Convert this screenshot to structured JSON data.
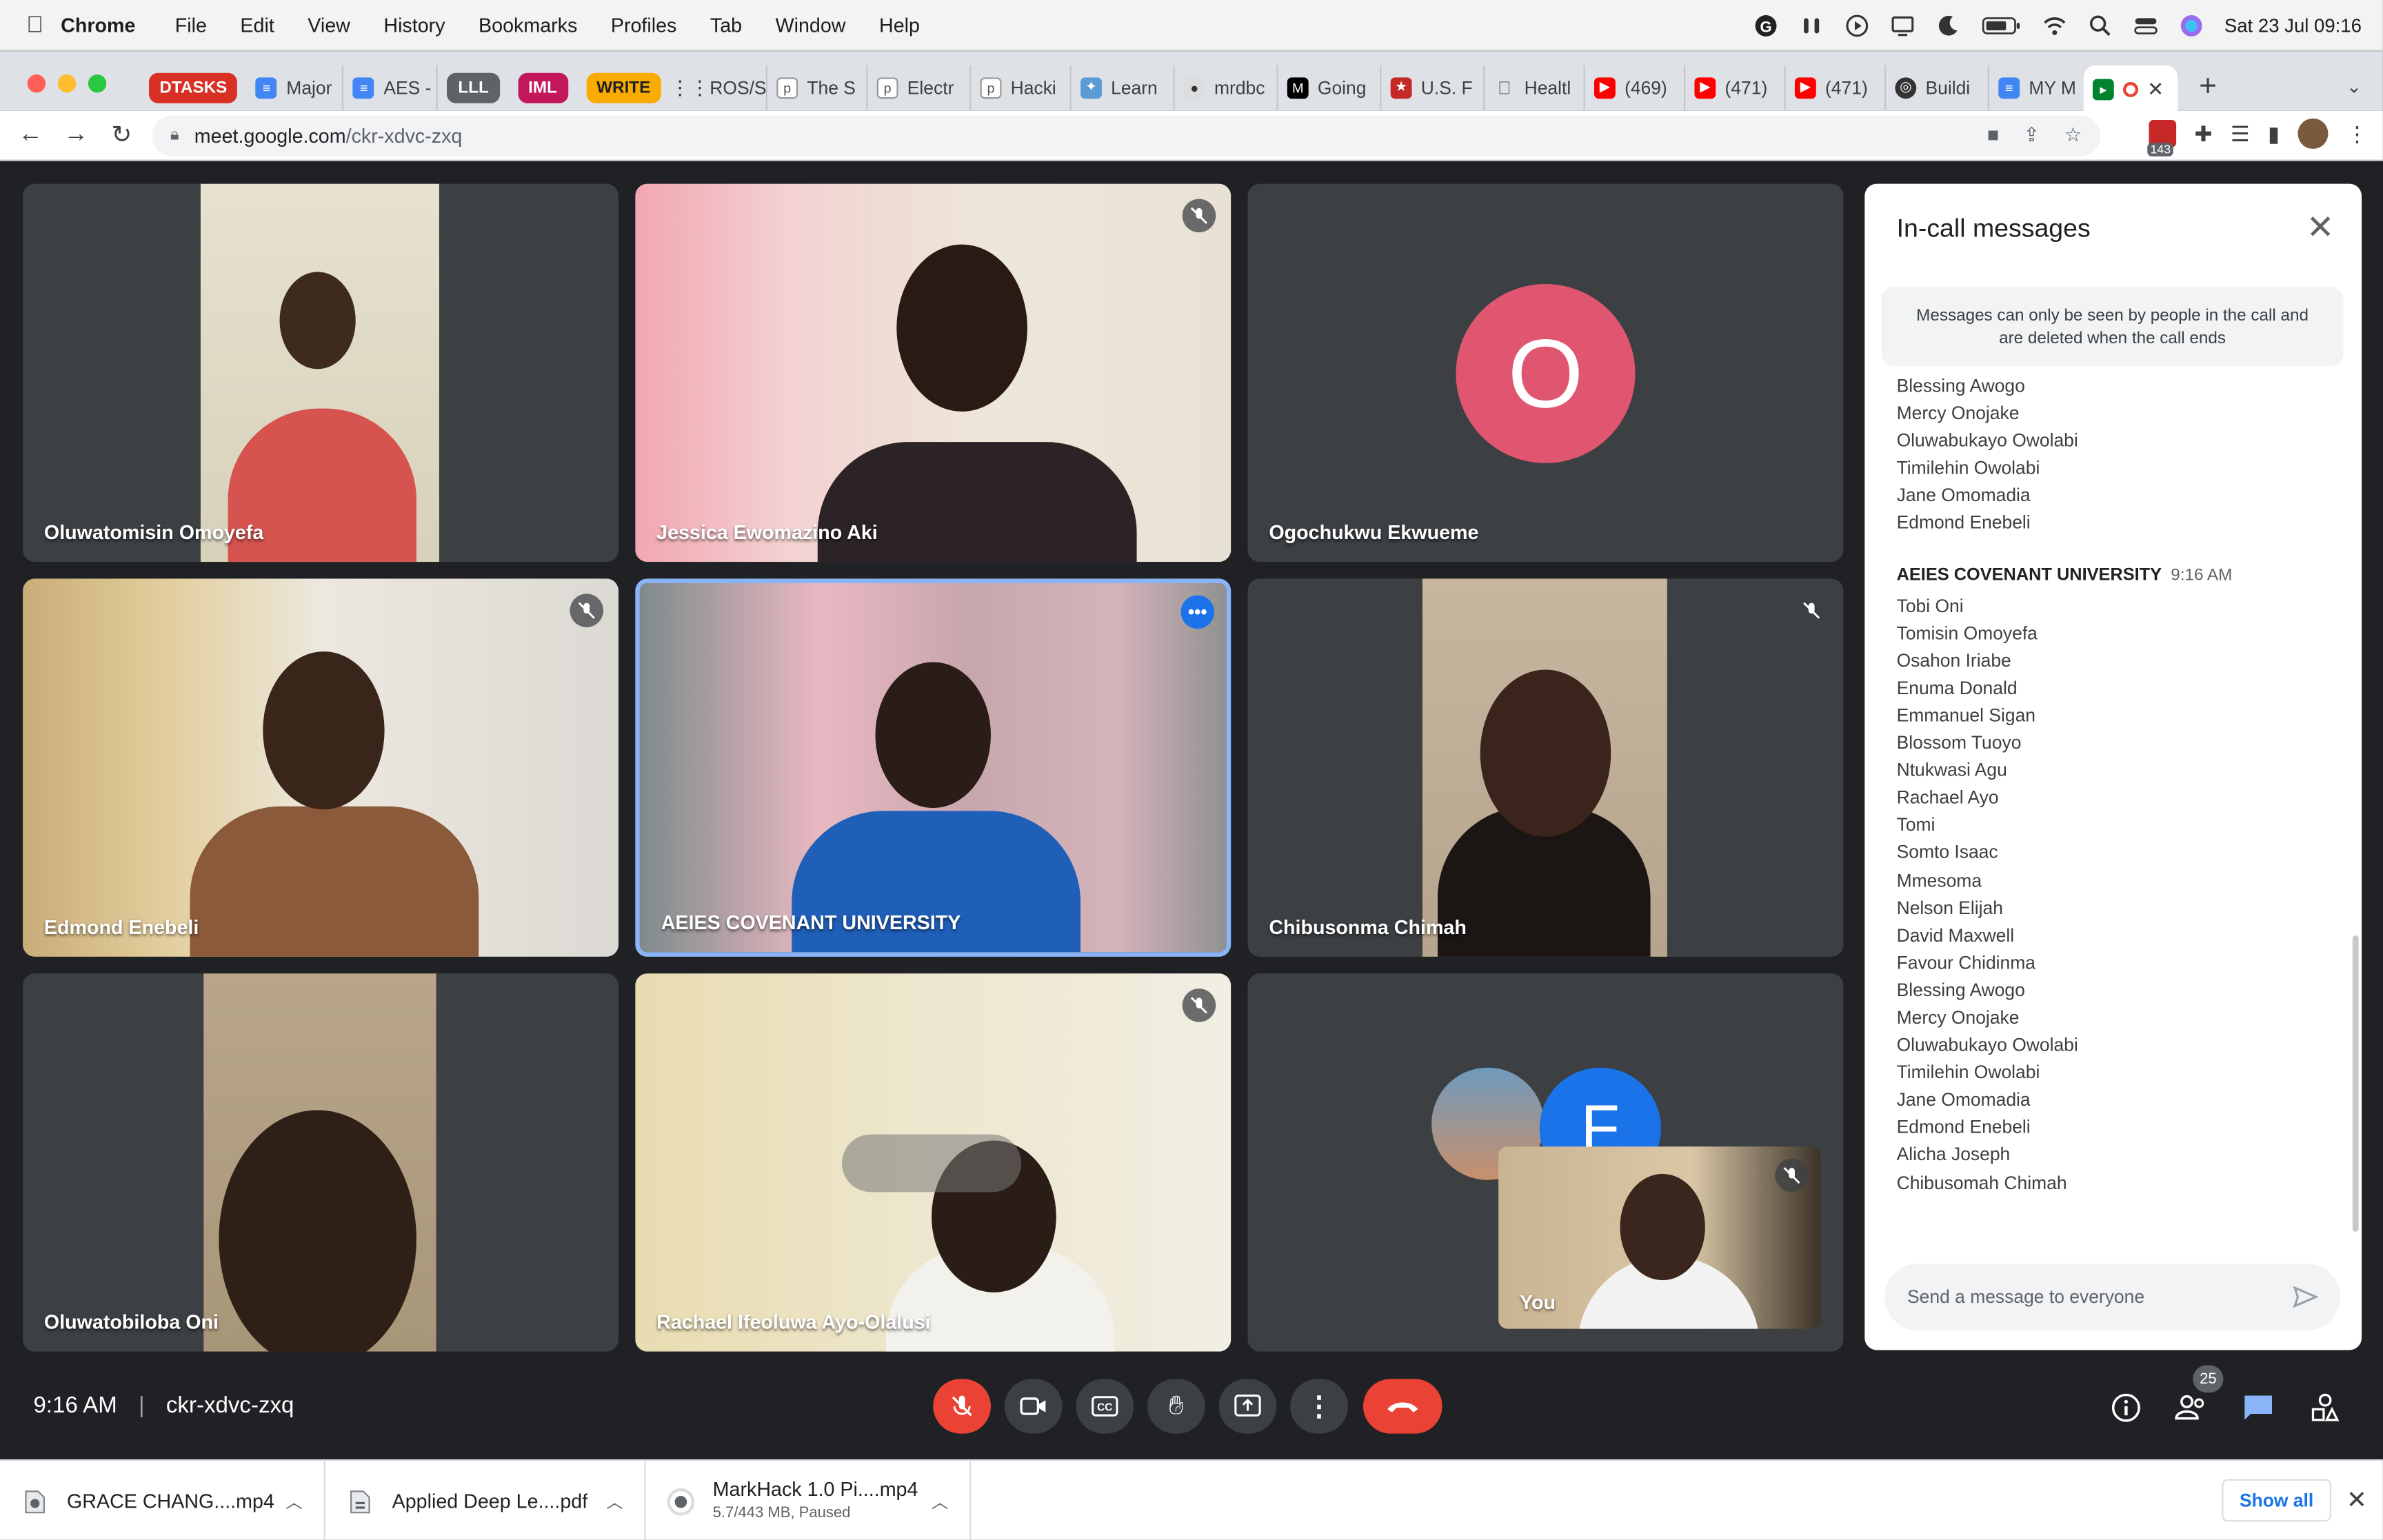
{
  "menubar": {
    "apple_icon": "apple-icon",
    "items": [
      "Chrome",
      "File",
      "Edit",
      "View",
      "History",
      "Bookmarks",
      "Profiles",
      "Tab",
      "Window",
      "Help"
    ],
    "datetime": "Sat 23 Jul  09:16"
  },
  "tabs": {
    "groups": [
      {
        "label": "DTASKS",
        "color": "#d93025"
      },
      {
        "label": "LLL",
        "color": "#5f6368"
      },
      {
        "label": "IML",
        "color": "#c2185b"
      },
      {
        "label": "WRITE",
        "color": "#f9ab00"
      }
    ],
    "items": [
      "Major",
      "AES -",
      "ROS/S",
      "The S",
      "Electr",
      "Hacki",
      "Learn",
      "mrdbc",
      "Going",
      "U.S. F",
      "Healtl",
      "(469)",
      "(471)",
      "(471)",
      "Buildi",
      "MY M"
    ],
    "new_tab": "+"
  },
  "address": {
    "host": "meet.google.com",
    "path": "/ckr-xdvc-zxq"
  },
  "extensions": {
    "badge": "143"
  },
  "participants": [
    {
      "name": "Oluwatomisin Omoyefa",
      "muted": false
    },
    {
      "name": "Jessica Ewomazino Aki",
      "muted": true
    },
    {
      "name": "Ogochukwu Ekwueme",
      "muted": false,
      "avatar_letter": "O",
      "avatar_color": "#e0556f"
    },
    {
      "name": "Edmond Enebeli",
      "muted": true
    },
    {
      "name": "AEIES COVENANT UNIVERSITY",
      "muted": false
    },
    {
      "name": "Chibusonma Chimah",
      "muted": true
    },
    {
      "name": "Oluwatobiloba Oni",
      "muted": false
    },
    {
      "name": "Rachael Ifeoluwa Ayo-Olalusi",
      "muted": true
    },
    {
      "name": "You",
      "muted": true,
      "other_avatar_letter": "F"
    }
  ],
  "chat": {
    "title": "In-call messages",
    "info": "Messages can only be seen by people in the call and are deleted when the call ends",
    "top_lines": [
      "Blessing Awogo",
      "Mercy Onojake",
      "Oluwabukayo Owolabi",
      "Timilehin Owolabi",
      "Jane Omomadia",
      "Edmond Enebeli"
    ],
    "sender": "AEIES COVENANT UNIVERSITY",
    "time": "9:16 AM",
    "lines": [
      "Tobi Oni",
      "Tomisin Omoyefa",
      "Osahon Iriabe",
      "Enuma Donald",
      "Emmanuel Sigan",
      "Blossom Tuoyo",
      "Ntukwasi Agu",
      "Rachael Ayo",
      "Tomi",
      "Somto Isaac",
      "Mmesoma",
      "Nelson Elijah",
      "David Maxwell",
      "Favour Chidinma",
      "Blessing Awogo",
      "Mercy Onojake",
      "Oluwabukayo Owolabi",
      "Timilehin Owolabi",
      "Jane Omomadia",
      "Edmond Enebeli",
      "Alicha Joseph",
      "Chibusomah Chimah"
    ],
    "input_placeholder": "Send a message to everyone"
  },
  "meetbar": {
    "time": "9:16 AM",
    "code": "ckr-xdvc-zxq",
    "people_count": "25"
  },
  "downloads": [
    {
      "name": "GRACE CHANG....mp4",
      "status": ""
    },
    {
      "name": "Applied Deep Le....pdf",
      "status": ""
    },
    {
      "name": "MarkHack 1.0 Pi....mp4",
      "status": "5.7/443 MB, Paused"
    }
  ],
  "show_all": "Show all"
}
